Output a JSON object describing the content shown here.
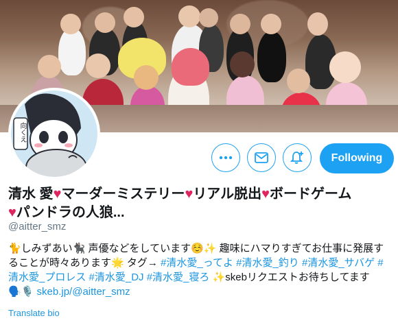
{
  "profile": {
    "name_parts": [
      "清水 愛",
      "マーダーミステリー",
      "リアル脱出",
      "ボードゲーム",
      "パンドラの人狼..."
    ],
    "handle": "@aitter_smz"
  },
  "avatar_text": "向くえ",
  "actions": {
    "more_icon": "more-icon",
    "message_icon": "envelope-icon",
    "notify_icon": "bell-plus-icon",
    "follow_label": "Following"
  },
  "bio": {
    "line1_a": "🐈しみずあい🐈‍⬛ 声優などをしています☺️✨ 趣味にハマりすぎてお仕事に発展することが時々あります🌟 タグ→ ",
    "tags": [
      "#清水愛_ってよ",
      "#清水愛_釣り",
      "#清水愛_サバゲ",
      "#清水愛_プロレス",
      "#清水愛_DJ",
      "#清水愛_寝ろ"
    ],
    "tail": " ✨skebリクエストお待ちしてます　🗣️🎙️ ",
    "url": "skeb.jp/@aitter_smz"
  },
  "translate_label": "Translate bio",
  "colors": {
    "accent": "#1da1f2",
    "heart": "#e0245e",
    "muted": "#657786"
  }
}
